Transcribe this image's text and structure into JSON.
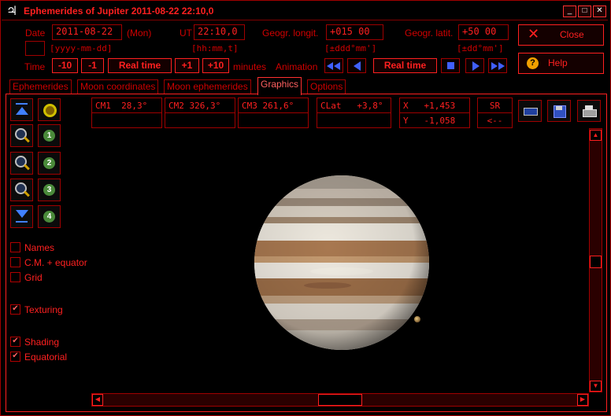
{
  "titlebar": {
    "logo": "♃",
    "title": "Ephemerides of Jupiter  2011-08-22  22:10,0",
    "min": "_",
    "max": "□",
    "close": "✕"
  },
  "inputs": {
    "date_label": "Date",
    "date_value": "2011-08-22",
    "day": "(Mon)",
    "date_format": "[yyyy-mm-dd]",
    "ut_label": "UT",
    "ut_value": "22:10,0",
    "ut_format": "[hh:mm,t]",
    "longit_label": "Geogr. longit.",
    "longit_value": "+015 00",
    "longit_format": "[±ddd°mm']",
    "latit_label": "Geogr. latit.",
    "latit_value": "+50 00",
    "latit_format": "[±dd°mm']"
  },
  "time_row": {
    "label": "Time",
    "m10": "-10",
    "m1": "-1",
    "realtime": "Real time",
    "p1": "+1",
    "p10": "+10",
    "unit": "minutes",
    "animation_label": "Animation",
    "anim_realtime": "Real time"
  },
  "buttons": {
    "close": "Close",
    "help": "Help"
  },
  "tabs": [
    {
      "label": "Ephemerides"
    },
    {
      "label": "Moon coordinates"
    },
    {
      "label": "Moon ephemerides"
    },
    {
      "label": "Graphics"
    },
    {
      "label": "Options"
    }
  ],
  "readouts": {
    "cm1": "CM1  28,3°",
    "cm2": "CM2 326,3°",
    "cm3": "CM3 261,6°",
    "clat": "CLat   +3,8°",
    "x": "X   +1,453",
    "y": "Y   -1,058",
    "sr": "SR",
    "back": "<--"
  },
  "checkboxes": [
    {
      "label": "Names",
      "checked": false
    },
    {
      "label": "C.M. + equator",
      "checked": false
    },
    {
      "label": "Grid",
      "checked": false
    },
    {
      "label": "Texturing",
      "checked": true
    },
    {
      "label": "Shading",
      "checked": true
    },
    {
      "label": "Equatorial",
      "checked": true
    }
  ],
  "moon_buttons": [
    "1",
    "2",
    "3",
    "4"
  ],
  "colors": {
    "accent": "#ff2020",
    "frame": "#a00000",
    "background": "#000000"
  }
}
